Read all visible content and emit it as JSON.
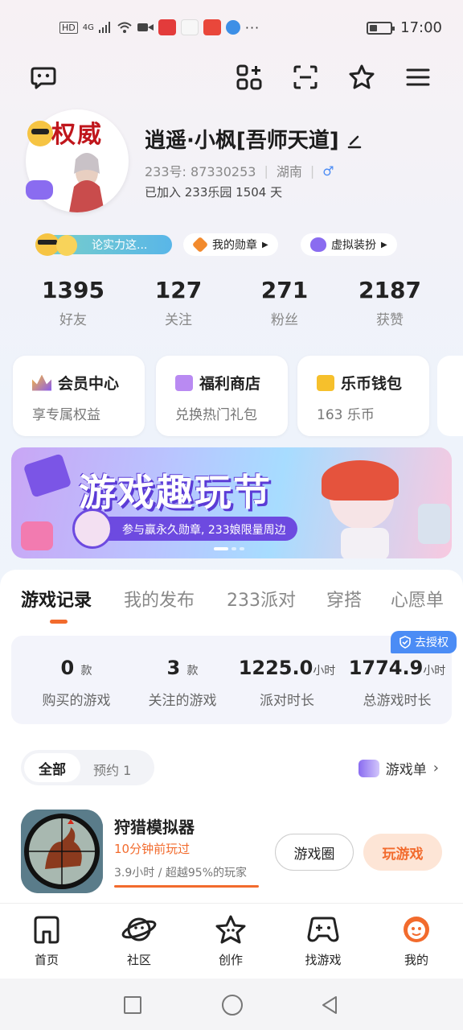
{
  "status_bar": {
    "left_icons": [
      "HD",
      "4G"
    ],
    "time": "17:00"
  },
  "toolbar": {
    "icons": [
      "chat-icon",
      "apps-icon",
      "scan-icon",
      "badge-star-icon",
      "menu-icon"
    ]
  },
  "profile": {
    "avatar_text": "权威",
    "username": "逍遥·小枫[吾师天道]",
    "id_label": "233号:",
    "id_value": "87330253",
    "location": "湖南",
    "gender": "♂",
    "joined": "已加入 233乐园 1504 天"
  },
  "tags": {
    "strength": "论实力这...",
    "medals": "我的勋章",
    "dressup": "虚拟装扮"
  },
  "stats": [
    {
      "num": "1395",
      "label": "好友"
    },
    {
      "num": "127",
      "label": "关注"
    },
    {
      "num": "271",
      "label": "粉丝"
    },
    {
      "num": "2187",
      "label": "获赞"
    }
  ],
  "cards": [
    {
      "title": "会员中心",
      "sub": "享专属权益"
    },
    {
      "title": "福利商店",
      "sub": "兑换热门礼包"
    },
    {
      "title": "乐币钱包",
      "sub": "163 乐币"
    }
  ],
  "banner": {
    "title": "游戏趣玩节",
    "subtitle": "参与赢永久勋章, 233娘限量周边"
  },
  "tabs": [
    "游戏记录",
    "我的发布",
    "233派对",
    "穿搭",
    "心愿单"
  ],
  "records": [
    {
      "value": "0",
      "unit": "款",
      "label": "购买的游戏"
    },
    {
      "value": "3",
      "unit": "款",
      "label": "关注的游戏"
    },
    {
      "value": "1225.0",
      "unit": "小时",
      "label": "派对时长"
    },
    {
      "value": "1774.9",
      "unit": "小时",
      "label": "总游戏时长"
    }
  ],
  "auth_badge": "去授权",
  "filter": {
    "all": "全部",
    "reserved": "预约 1",
    "gamelist": "游戏单"
  },
  "game": {
    "name": "狩猎模拟器",
    "recent": "10分钟前玩过",
    "stat": "3.9小时 / 超越95%的玩家",
    "circle_btn": "游戏圈",
    "play_btn": "玩游戏"
  },
  "bottom_nav": [
    {
      "label": "首页",
      "icon": "home-icon"
    },
    {
      "label": "社区",
      "icon": "planet-icon"
    },
    {
      "label": "创作",
      "icon": "star-create-icon"
    },
    {
      "label": "找游戏",
      "icon": "gamepad-icon"
    },
    {
      "label": "我的",
      "icon": "profile-face-icon"
    }
  ],
  "colors": {
    "accent": "#f26b2d",
    "badge_blue": "#4b8cf5",
    "banner_purple": "#6d4ae0"
  }
}
